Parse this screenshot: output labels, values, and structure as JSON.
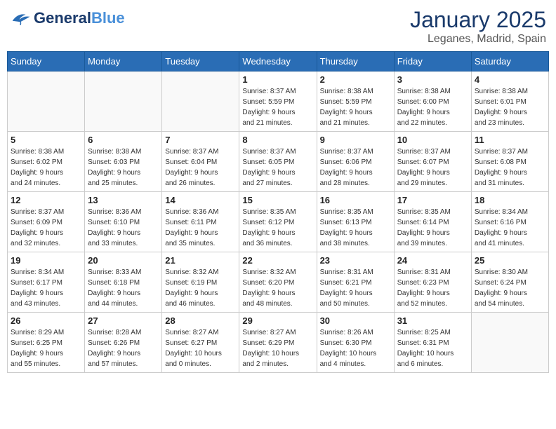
{
  "header": {
    "logo_general": "General",
    "logo_blue": "Blue",
    "month": "January 2025",
    "location": "Leganes, Madrid, Spain"
  },
  "weekdays": [
    "Sunday",
    "Monday",
    "Tuesday",
    "Wednesday",
    "Thursday",
    "Friday",
    "Saturday"
  ],
  "weeks": [
    [
      {
        "day": "",
        "info": ""
      },
      {
        "day": "",
        "info": ""
      },
      {
        "day": "",
        "info": ""
      },
      {
        "day": "1",
        "info": "Sunrise: 8:37 AM\nSunset: 5:59 PM\nDaylight: 9 hours\nand 21 minutes."
      },
      {
        "day": "2",
        "info": "Sunrise: 8:38 AM\nSunset: 5:59 PM\nDaylight: 9 hours\nand 21 minutes."
      },
      {
        "day": "3",
        "info": "Sunrise: 8:38 AM\nSunset: 6:00 PM\nDaylight: 9 hours\nand 22 minutes."
      },
      {
        "day": "4",
        "info": "Sunrise: 8:38 AM\nSunset: 6:01 PM\nDaylight: 9 hours\nand 23 minutes."
      }
    ],
    [
      {
        "day": "5",
        "info": "Sunrise: 8:38 AM\nSunset: 6:02 PM\nDaylight: 9 hours\nand 24 minutes."
      },
      {
        "day": "6",
        "info": "Sunrise: 8:38 AM\nSunset: 6:03 PM\nDaylight: 9 hours\nand 25 minutes."
      },
      {
        "day": "7",
        "info": "Sunrise: 8:37 AM\nSunset: 6:04 PM\nDaylight: 9 hours\nand 26 minutes."
      },
      {
        "day": "8",
        "info": "Sunrise: 8:37 AM\nSunset: 6:05 PM\nDaylight: 9 hours\nand 27 minutes."
      },
      {
        "day": "9",
        "info": "Sunrise: 8:37 AM\nSunset: 6:06 PM\nDaylight: 9 hours\nand 28 minutes."
      },
      {
        "day": "10",
        "info": "Sunrise: 8:37 AM\nSunset: 6:07 PM\nDaylight: 9 hours\nand 29 minutes."
      },
      {
        "day": "11",
        "info": "Sunrise: 8:37 AM\nSunset: 6:08 PM\nDaylight: 9 hours\nand 31 minutes."
      }
    ],
    [
      {
        "day": "12",
        "info": "Sunrise: 8:37 AM\nSunset: 6:09 PM\nDaylight: 9 hours\nand 32 minutes."
      },
      {
        "day": "13",
        "info": "Sunrise: 8:36 AM\nSunset: 6:10 PM\nDaylight: 9 hours\nand 33 minutes."
      },
      {
        "day": "14",
        "info": "Sunrise: 8:36 AM\nSunset: 6:11 PM\nDaylight: 9 hours\nand 35 minutes."
      },
      {
        "day": "15",
        "info": "Sunrise: 8:35 AM\nSunset: 6:12 PM\nDaylight: 9 hours\nand 36 minutes."
      },
      {
        "day": "16",
        "info": "Sunrise: 8:35 AM\nSunset: 6:13 PM\nDaylight: 9 hours\nand 38 minutes."
      },
      {
        "day": "17",
        "info": "Sunrise: 8:35 AM\nSunset: 6:14 PM\nDaylight: 9 hours\nand 39 minutes."
      },
      {
        "day": "18",
        "info": "Sunrise: 8:34 AM\nSunset: 6:16 PM\nDaylight: 9 hours\nand 41 minutes."
      }
    ],
    [
      {
        "day": "19",
        "info": "Sunrise: 8:34 AM\nSunset: 6:17 PM\nDaylight: 9 hours\nand 43 minutes."
      },
      {
        "day": "20",
        "info": "Sunrise: 8:33 AM\nSunset: 6:18 PM\nDaylight: 9 hours\nand 44 minutes."
      },
      {
        "day": "21",
        "info": "Sunrise: 8:32 AM\nSunset: 6:19 PM\nDaylight: 9 hours\nand 46 minutes."
      },
      {
        "day": "22",
        "info": "Sunrise: 8:32 AM\nSunset: 6:20 PM\nDaylight: 9 hours\nand 48 minutes."
      },
      {
        "day": "23",
        "info": "Sunrise: 8:31 AM\nSunset: 6:21 PM\nDaylight: 9 hours\nand 50 minutes."
      },
      {
        "day": "24",
        "info": "Sunrise: 8:31 AM\nSunset: 6:23 PM\nDaylight: 9 hours\nand 52 minutes."
      },
      {
        "day": "25",
        "info": "Sunrise: 8:30 AM\nSunset: 6:24 PM\nDaylight: 9 hours\nand 54 minutes."
      }
    ],
    [
      {
        "day": "26",
        "info": "Sunrise: 8:29 AM\nSunset: 6:25 PM\nDaylight: 9 hours\nand 55 minutes."
      },
      {
        "day": "27",
        "info": "Sunrise: 8:28 AM\nSunset: 6:26 PM\nDaylight: 9 hours\nand 57 minutes."
      },
      {
        "day": "28",
        "info": "Sunrise: 8:27 AM\nSunset: 6:27 PM\nDaylight: 10 hours\nand 0 minutes."
      },
      {
        "day": "29",
        "info": "Sunrise: 8:27 AM\nSunset: 6:29 PM\nDaylight: 10 hours\nand 2 minutes."
      },
      {
        "day": "30",
        "info": "Sunrise: 8:26 AM\nSunset: 6:30 PM\nDaylight: 10 hours\nand 4 minutes."
      },
      {
        "day": "31",
        "info": "Sunrise: 8:25 AM\nSunset: 6:31 PM\nDaylight: 10 hours\nand 6 minutes."
      },
      {
        "day": "",
        "info": ""
      }
    ]
  ]
}
